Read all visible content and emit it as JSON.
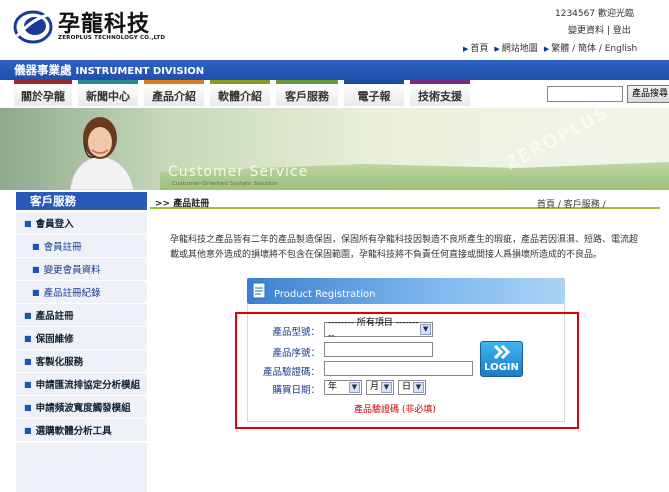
{
  "header": {
    "brand_cn": "孕龍科技",
    "brand_en": "ZEROPLUS TECHNOLOGY CO.,LTD",
    "welcome": "1234567 歡迎光臨",
    "user_links": "變更資料 | 登出",
    "top_links": [
      "首頁",
      "網站地圖",
      "繁體 / 簡体 / English"
    ],
    "division_cn": "儀器事業處",
    "division_en": "INSTRUMENT DIVISION"
  },
  "nav": {
    "items": [
      {
        "label": "關於孕龍",
        "color": "#9b2a2a"
      },
      {
        "label": "新聞中心",
        "color": "#2a8a8a"
      },
      {
        "label": "產品介紹",
        "color": "#e07a1a"
      },
      {
        "label": "軟體介紹",
        "color": "#8a9a1a"
      },
      {
        "label": "客戶服務",
        "color": "#6a9a3a"
      },
      {
        "label": "電子報",
        "color": "#1a4a9a"
      },
      {
        "label": "技術支援",
        "color": "#7a2a7a"
      }
    ],
    "search_button": "產品搜尋"
  },
  "banner": {
    "title": "Customer  Service",
    "subtitle": "Customer-Oriented System Solution",
    "watermark": "ZEROPLUS"
  },
  "sidebar": {
    "title": "客戶服務",
    "items": [
      {
        "label": "會員登入",
        "level": "top"
      },
      {
        "label": "會員註冊",
        "level": "sub"
      },
      {
        "label": "變更會員資料",
        "level": "sub"
      },
      {
        "label": "產品註冊紀錄",
        "level": "sub"
      },
      {
        "label": "產品註冊",
        "level": "top"
      },
      {
        "label": "保固維修",
        "level": "top"
      },
      {
        "label": "客製化服務",
        "level": "top"
      },
      {
        "label": "申請匯流排協定分析模組",
        "level": "top"
      },
      {
        "label": "申請頻波寬度觸發模組",
        "level": "top"
      },
      {
        "label": "選購軟體分析工具",
        "level": "top"
      }
    ]
  },
  "main": {
    "section_title": ">> 產品註冊",
    "breadcrumb": "首頁 / 客戶服務 /",
    "intro": "孕龍科技之產品皆有二年的產品製造保固，保固所有孕龍科技因製造不良所產生的瑕疵，產品若因濕濕、短路、電流超載或其他意外造成的損壞將不包含在保固範圍，孕龍科技將不負責任何直接或間接人爲損壞所造成的不良品。",
    "form_title": "Product Registration",
    "fields": {
      "model_label": "產品型號：",
      "model_value": "-------- 所有項目 ---------",
      "serial_label": "產品序號：",
      "serial_value": "",
      "verify_label": "產品驗證碼：",
      "verify_value": "",
      "date_label": "購買日期：",
      "year": "年",
      "month": "月",
      "day": "日"
    },
    "login_label": "LOGIN",
    "note": "產品驗證碼 (非必填)"
  }
}
